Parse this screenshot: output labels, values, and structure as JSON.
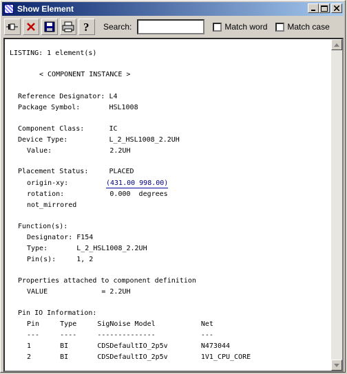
{
  "window": {
    "title": "Show Element"
  },
  "toolbar": {
    "search_label": "Search:",
    "search_value": "",
    "match_word_label": "Match word",
    "match_case_label": "Match case"
  },
  "listing": [
    {
      "text": "LISTING: 1 element(s)",
      "indent": 0
    },
    {
      "text": "< COMPONENT INSTANCE >",
      "indent": 7
    },
    {
      "text": "Reference Designator: L4",
      "indent": 2
    },
    {
      "text": "Package Symbol:       HSL1008",
      "indent": 2
    },
    {
      "text": "Component Class:      IC",
      "indent": 2
    },
    {
      "text": "Device Type:          L_2_HSL1008_2.2UH",
      "indent": 2
    },
    {
      "text": "Value:              2.2UH",
      "indent": 4
    },
    {
      "text": "Placement Status:     PLACED",
      "indent": 2
    },
    {
      "text": "origin-xy:",
      "indent": 4
    },
    {
      "text": "(431.00 998.00)",
      "indent": 0
    },
    {
      "text": "rotation:           0.000  degrees",
      "indent": 4
    },
    {
      "text": "not_mirrored",
      "indent": 4
    },
    {
      "text": "Function(s):",
      "indent": 2
    },
    {
      "text": "Designator: F154",
      "indent": 4
    },
    {
      "text": "Type:       L_2_HSL1008_2.2UH",
      "indent": 4
    },
    {
      "text": "Pin(s):     1, 2",
      "indent": 4
    },
    {
      "text": "Properties attached to component definition",
      "indent": 2
    },
    {
      "text": "VALUE             = 2.2UH",
      "indent": 4
    },
    {
      "text": "Pin IO Information:",
      "indent": 2
    },
    {
      "text": "Pin     Type     SigNoise Model           Net",
      "indent": 4
    },
    {
      "text": "---     ----     --------------           ---",
      "indent": 4
    },
    {
      "text": "1       BI       CDSDefaultIO_2p5v        N473044",
      "indent": 4
    },
    {
      "text": "2       BI       CDSDefaultIO_2p5v        1V1_CPU_CORE",
      "indent": 4
    }
  ]
}
